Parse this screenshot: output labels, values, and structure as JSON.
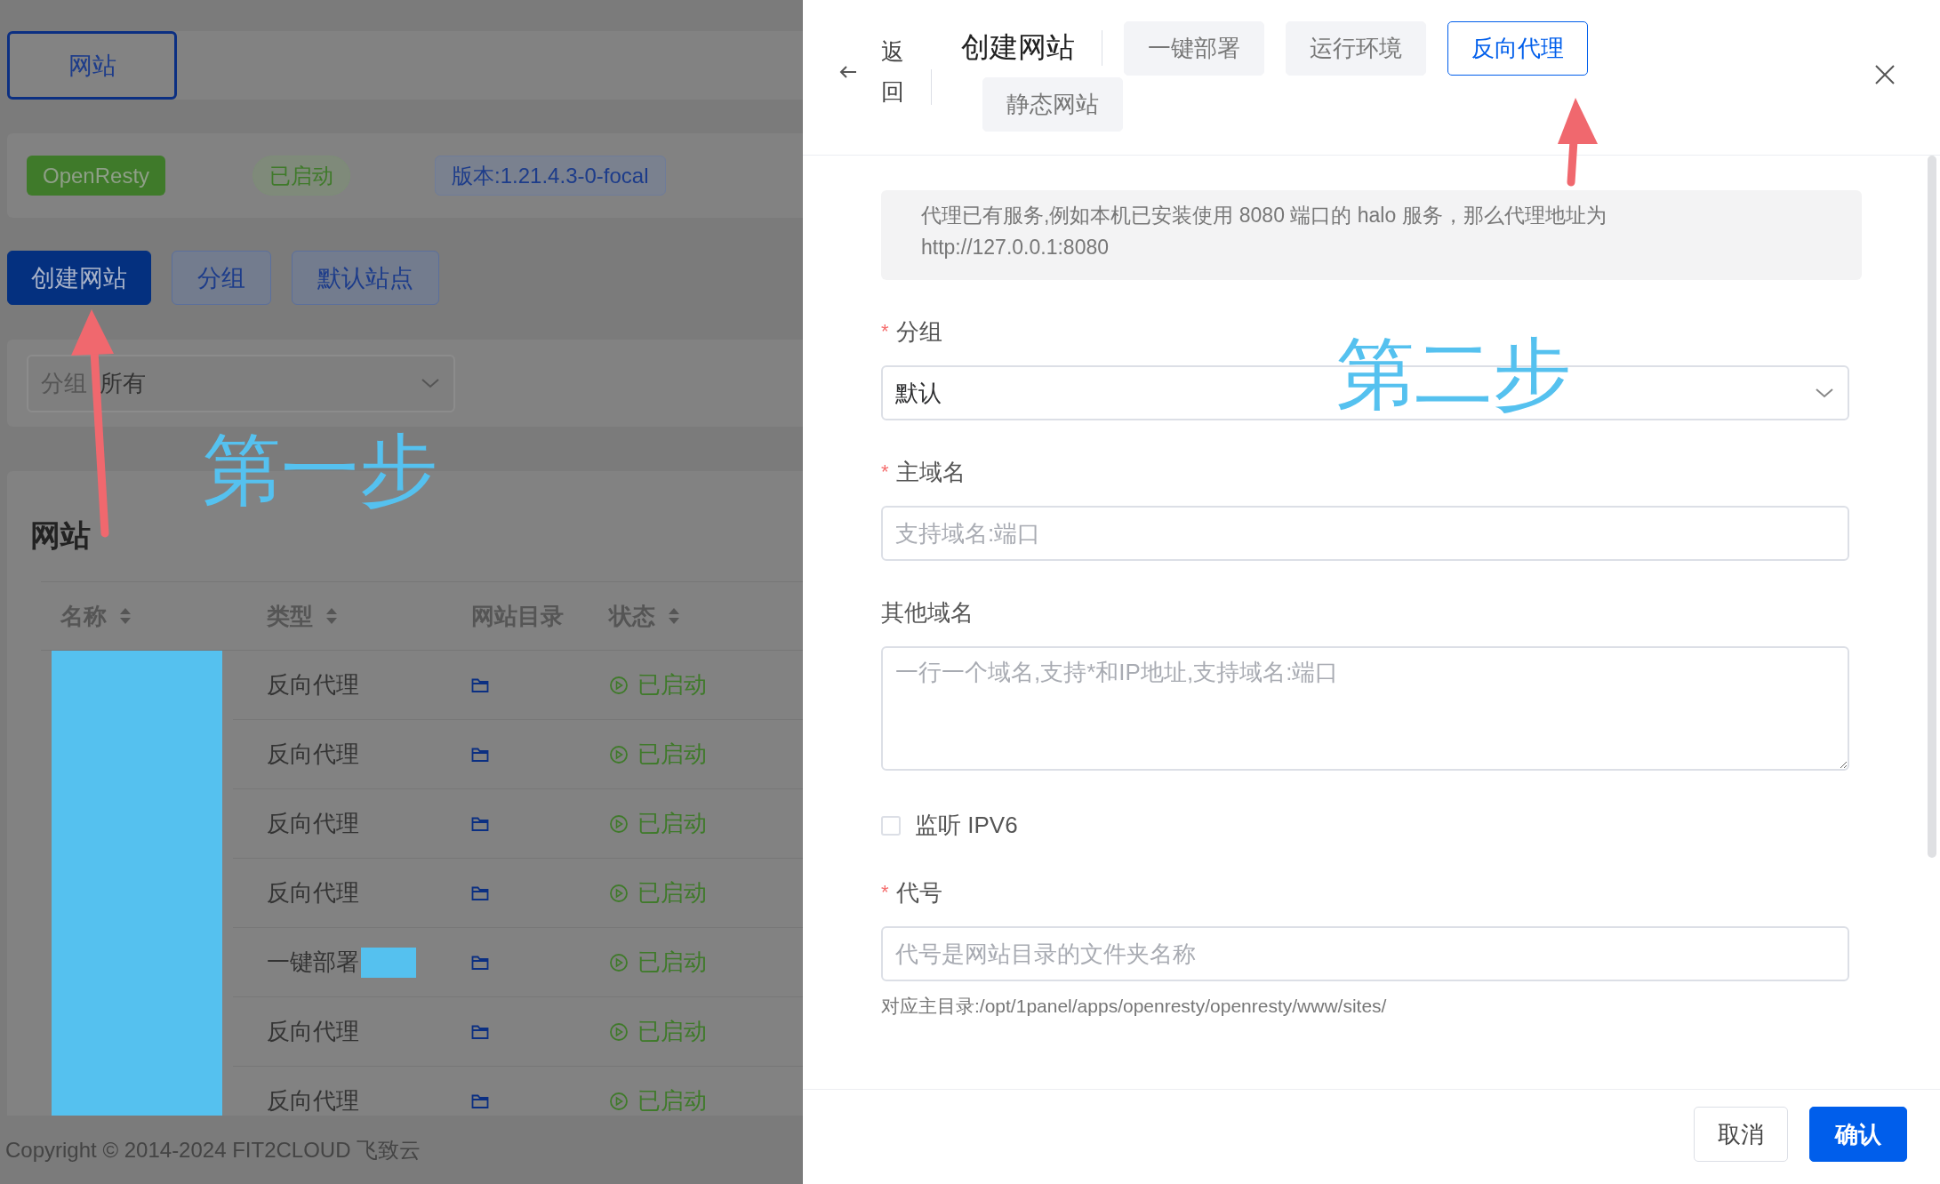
{
  "background_page": {
    "nav_tab": {
      "label": "网站",
      "selected": true
    },
    "app_status": {
      "name": "OpenResty",
      "status": "已启动",
      "version": "版本:1.21.4.3-0-focal"
    },
    "actions": [
      {
        "label": "创建网站",
        "kind": "primary"
      },
      {
        "label": "分组",
        "kind": "plain"
      },
      {
        "label": "默认站点",
        "kind": "plain"
      }
    ],
    "filter": {
      "label": "分组",
      "value": "所有"
    },
    "table": {
      "title": "网站",
      "columns": [
        {
          "label": "名称",
          "sortable": true
        },
        {
          "label": "类型",
          "sortable": true
        },
        {
          "label": "网站目录",
          "sortable": false
        },
        {
          "label": "状态",
          "sortable": true
        }
      ],
      "rows": [
        {
          "type": "反向代理",
          "type_redacted": false,
          "status": "已启动"
        },
        {
          "type": "反向代理",
          "type_redacted": false,
          "status": "已启动"
        },
        {
          "type": "反向代理",
          "type_redacted": false,
          "status": "已启动"
        },
        {
          "type": "反向代理",
          "type_redacted": false,
          "status": "已启动"
        },
        {
          "type": "一键部署",
          "type_redacted": true,
          "status": "已启动"
        },
        {
          "type": "反向代理",
          "type_redacted": false,
          "status": "已启动"
        },
        {
          "type": "反向代理",
          "type_redacted": false,
          "status": "已启动"
        }
      ]
    },
    "footer": "Copyright © 2014-2024 FIT2CLOUD 飞致云"
  },
  "drawer": {
    "back": "返回",
    "title": "创建网站",
    "tabs": [
      {
        "label": "一键部署",
        "selected": false
      },
      {
        "label": "运行环境",
        "selected": false
      },
      {
        "label": "反向代理",
        "selected": true
      },
      {
        "label": "静态网站",
        "selected": false
      }
    ],
    "notice": "代理已有服务,例如本机已安装使用 8080 端口的 halo 服务，那么代理地址为 http://127.0.0.1:8080",
    "fields": [
      {
        "kind": "select",
        "required_mark": "*",
        "label": "分组",
        "value": "默认"
      },
      {
        "kind": "input",
        "required_mark": "*",
        "label": "主域名",
        "placeholder": "支持域名:端口"
      },
      {
        "kind": "textarea",
        "label": "其他域名",
        "placeholder": "一行一个域名,支持*和IP地址,支持域名:端口"
      },
      {
        "kind": "checkbox",
        "label": "监听 IPV6",
        "checked": false
      },
      {
        "kind": "input",
        "required_mark": "*",
        "label": "代号",
        "placeholder": "代号是网站目录的文件夹名称",
        "hint": "对应主目录:/opt/1panel/apps/openresty/openresty/www/sites/"
      }
    ],
    "buttons": [
      {
        "label": "取消",
        "kind": "plain"
      },
      {
        "label": "确认",
        "kind": "primary"
      }
    ]
  },
  "annotations": [
    {
      "text": "第一步"
    },
    {
      "text": "第二步"
    }
  ]
}
